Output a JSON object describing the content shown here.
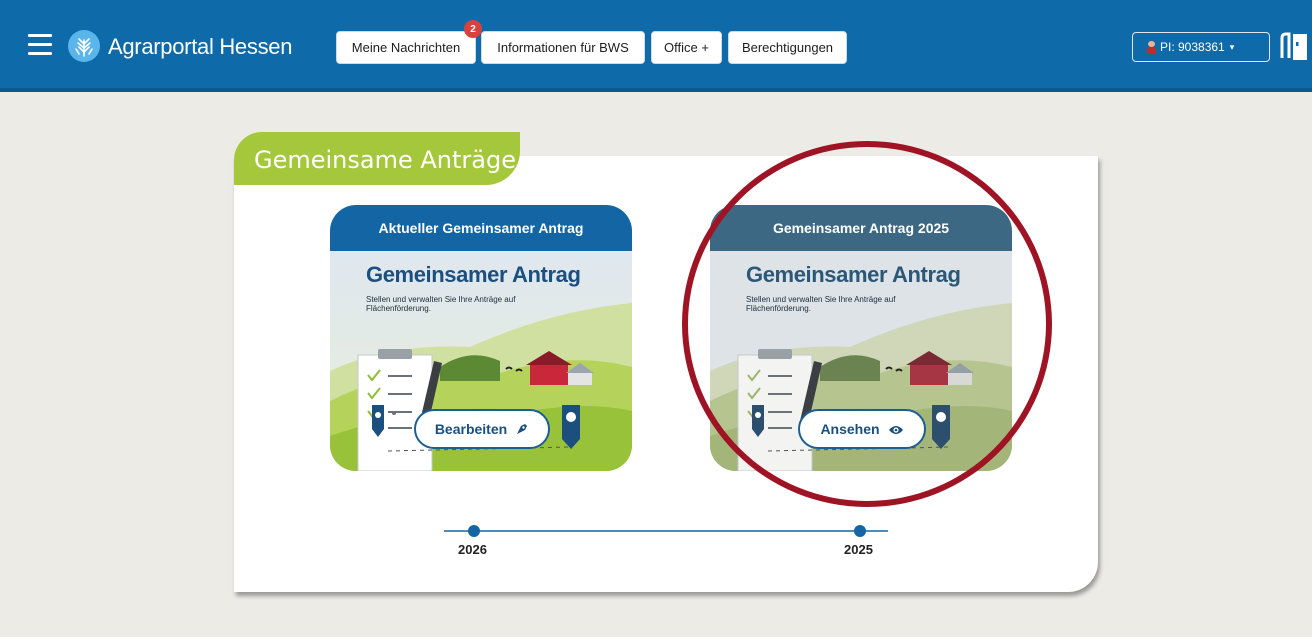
{
  "header": {
    "brand": "Agrarportal Hessen",
    "nav": [
      {
        "label": "Meine Nachrichten",
        "badge": "2"
      },
      {
        "label": "Informationen für BWS"
      },
      {
        "label": "Office +"
      },
      {
        "label": "Berechtigungen"
      }
    ],
    "user_label": "PI: 9038361",
    "icons": {
      "menu": "hamburger-menu-icon",
      "logo": "wheat-leaf-logo-icon",
      "user": "user-icon",
      "logout": "exit-door-icon"
    }
  },
  "section": {
    "title": "Gemeinsame Anträge"
  },
  "cards": [
    {
      "header": "Aktueller Gemeinsamer Antrag",
      "title": "Gemeinsamer Antrag",
      "subtitle": "Stellen und verwalten Sie Ihre Anträge auf Flächenförderung.",
      "button": "Bearbeiten",
      "button_icon": "pen-nib-icon",
      "header_color": "#1366a3"
    },
    {
      "header": "Gemeinsamer Antrag 2025",
      "title": "Gemeinsamer Antrag",
      "subtitle": "Stellen und verwalten Sie Ihre Anträge auf Flächenförderung.",
      "button": "Ansehen",
      "button_icon": "eye-icon",
      "header_color": "#3c6883"
    }
  ],
  "timeline": {
    "years": [
      "2026",
      "2025"
    ]
  },
  "colors": {
    "topbar": "#0e6aa8",
    "accent_green": "#a5c73b",
    "highlight_circle": "#9e1424"
  }
}
